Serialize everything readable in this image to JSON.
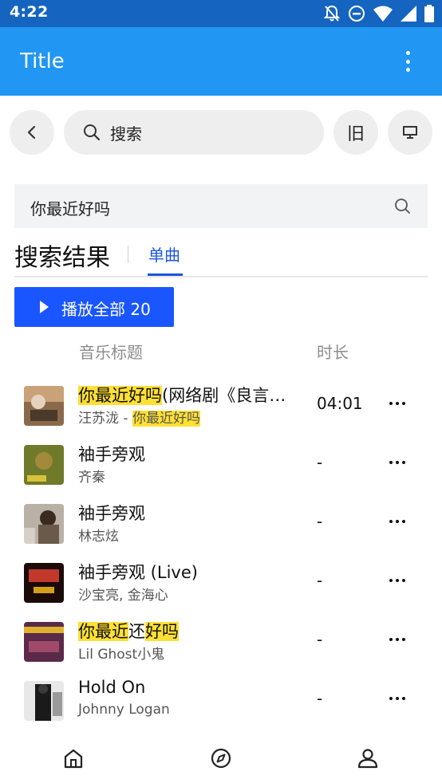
{
  "status_bar": {
    "time": "4:22",
    "icons": [
      "notifications-off-icon",
      "do-not-disturb-icon",
      "wifi-icon",
      "signal-icon",
      "battery-icon"
    ]
  },
  "app_bar": {
    "title": "Title",
    "menu_icon": "more-vert-icon"
  },
  "toolbar": {
    "back_icon": "chevron-left-icon",
    "search_placeholder": "搜索",
    "old_button_label": "旧",
    "screen_icon": "desktop-icon"
  },
  "query": {
    "value": "你最近好吗",
    "icon": "search-icon"
  },
  "results": {
    "heading": "搜索结果",
    "tab_label": "单曲",
    "play_all_label": "播放全部 20",
    "col_title": "音乐标题",
    "col_duration": "时长",
    "songs": [
      {
        "title_hl": "你最近好吗",
        "title_rest": "(网络剧《良言写意》插曲)",
        "artist_prefix": "汪苏泷 - ",
        "artist_hl": "你最近好吗",
        "duration": "04:01",
        "cover": "#8a6a4a"
      },
      {
        "title_rest": "袖手旁观",
        "artist_prefix": "齐秦",
        "duration": "-",
        "cover": "#6f7a2a"
      },
      {
        "title_rest": "袖手旁观",
        "artist_prefix": "林志炫",
        "duration": "-",
        "cover": "#b9b0a6"
      },
      {
        "title_rest": "袖手旁观 (Live)",
        "artist_prefix": "沙宝亮, 金海心",
        "duration": "-",
        "cover": "#3a1a12"
      },
      {
        "title_hl": "你最近",
        "title_mid": "还",
        "title_hl2": "好吗",
        "artist_prefix": "Lil Ghost小鬼",
        "duration": "-",
        "cover": "#5a2a48"
      },
      {
        "title_rest": "Hold On",
        "artist_prefix": "Johnny Logan",
        "duration": "-",
        "cover": "#2a2a2a"
      }
    ]
  },
  "bottom_nav": {
    "items": [
      "home-icon",
      "explore-icon",
      "profile-icon"
    ]
  }
}
